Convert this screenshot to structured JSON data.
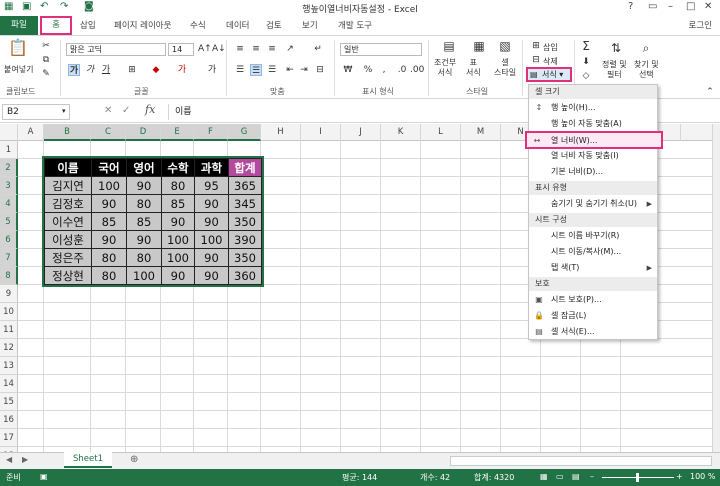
{
  "window": {
    "title": "행높이열너비자동설정 - Excel",
    "login": "로그인"
  },
  "tabs": [
    "파일",
    "홈",
    "삽입",
    "페이지 레이아웃",
    "수식",
    "데이터",
    "검토",
    "보기",
    "개발 도구"
  ],
  "ribbon": {
    "paste_label": "붙여넣기",
    "font_name": "맑은 고딕",
    "font_size": "14",
    "number_format": "일반",
    "cond_format": "조건부\n서식",
    "table_format": "표\n서식",
    "cell_style": "셀\n스타일",
    "insert": "삽입",
    "delete": "삭제",
    "format": "서식",
    "sort": "정렬 및\n필터",
    "find": "찾기 및\n선택",
    "group_labels": [
      "클립보드",
      "글꼴",
      "맞춤",
      "표시 형식",
      "스타일"
    ],
    "percent": "%",
    "comma": ","
  },
  "formula_bar": {
    "name_box": "B2",
    "fx": "fx",
    "content": "이름"
  },
  "columns": [
    "A",
    "B",
    "C",
    "D",
    "E",
    "F",
    "G",
    "H",
    "I",
    "J",
    "K",
    "L",
    "M",
    "N",
    "O",
    "P",
    "Q"
  ],
  "rows": [
    "1",
    "2",
    "3",
    "4",
    "5",
    "6",
    "7",
    "8",
    "9",
    "10",
    "11",
    "12",
    "13",
    "14",
    "15",
    "16",
    "17",
    "18"
  ],
  "table": {
    "headers": [
      "이름",
      "국어",
      "영어",
      "수학",
      "과학",
      "합계"
    ],
    "rows": [
      [
        "김지연",
        "100",
        "90",
        "80",
        "95",
        "365"
      ],
      [
        "김정호",
        "90",
        "80",
        "85",
        "90",
        "345"
      ],
      [
        "이수연",
        "85",
        "85",
        "90",
        "90",
        "350"
      ],
      [
        "이성훈",
        "90",
        "90",
        "100",
        "100",
        "390"
      ],
      [
        "정은주",
        "80",
        "80",
        "100",
        "90",
        "350"
      ],
      [
        "정상현",
        "80",
        "100",
        "90",
        "90",
        "360"
      ]
    ]
  },
  "menu": {
    "sections": [
      {
        "header": "셀 크기",
        "items": [
          {
            "label": "행 높이(H)...",
            "icon": "row-height-icon"
          },
          {
            "label": "행 높이 자동 맞춤(A)",
            "icon": ""
          },
          {
            "label": "열 너비(W)...",
            "icon": "column-width-icon",
            "highlight": true
          },
          {
            "label": "열 너비 자동 맞춤(I)",
            "icon": ""
          },
          {
            "label": "기본 너비(D)...",
            "icon": ""
          }
        ]
      },
      {
        "header": "표시 유형",
        "items": [
          {
            "label": "숨기기 및 숨기기 취소(U)",
            "icon": "",
            "submenu": true
          }
        ]
      },
      {
        "header": "시트 구성",
        "items": [
          {
            "label": "시트 이름 바꾸기(R)",
            "icon": ""
          },
          {
            "label": "시트 이동/복사(M)...",
            "icon": ""
          },
          {
            "label": "탭 색(T)",
            "icon": "",
            "submenu": true
          }
        ]
      },
      {
        "header": "보호",
        "items": [
          {
            "label": "시트 보호(P)...",
            "icon": "protect-sheet-icon"
          },
          {
            "label": "셀 잠금(L)",
            "icon": "lock-icon"
          },
          {
            "label": "셀 서식(E)...",
            "icon": "format-cells-icon"
          }
        ]
      }
    ]
  },
  "sheet_tab": "Sheet1",
  "status": {
    "ready": "준비",
    "average": "평균: 144",
    "count": "개수: 42",
    "sum": "합계: 4320",
    "zoom": "100 %"
  }
}
